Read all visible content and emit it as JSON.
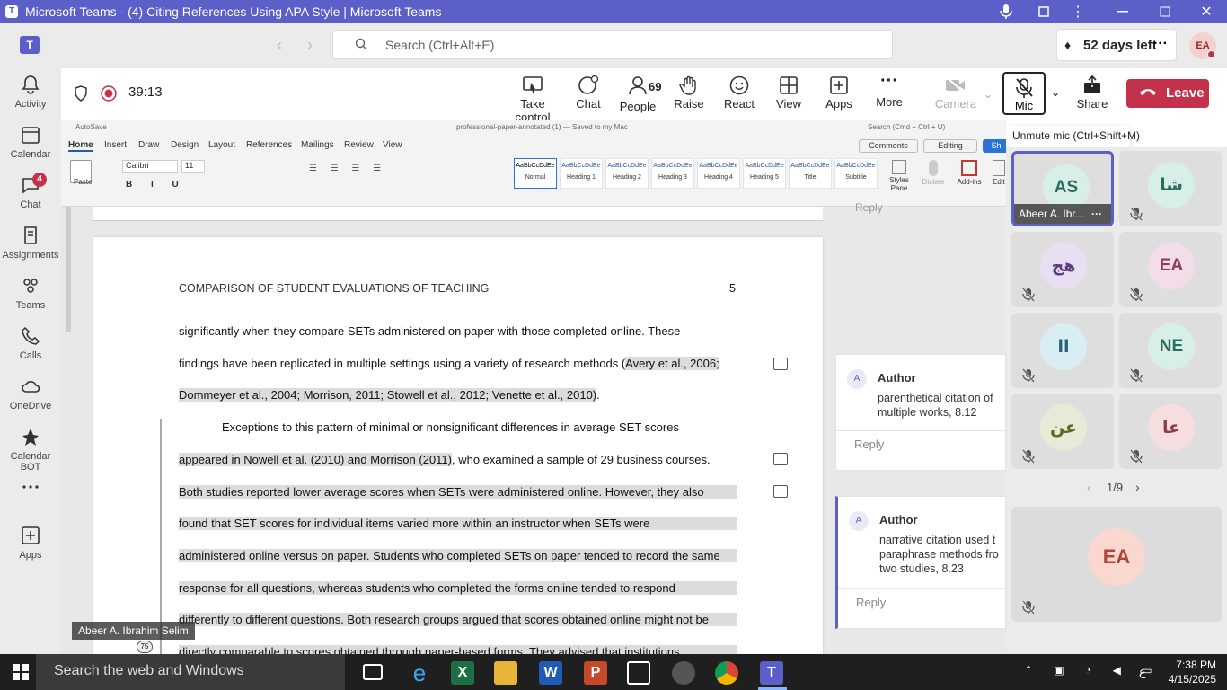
{
  "window": {
    "title": "Microsoft Teams - (4) Citing References Using APA Style | Microsoft Teams"
  },
  "topbar": {
    "search_placeholder": "Search (Ctrl+Alt+E)",
    "days_left": "52 days left",
    "avatar": "EA"
  },
  "rail": [
    {
      "label": "Activity",
      "icon": "bell-icon"
    },
    {
      "label": "Calendar",
      "icon": "calendar-icon"
    },
    {
      "label": "Chat",
      "icon": "chat-icon",
      "badge": "4"
    },
    {
      "label": "Assignments",
      "icon": "assignments-icon"
    },
    {
      "label": "Teams",
      "icon": "teams-icon"
    },
    {
      "label": "Calls",
      "icon": "phone-icon"
    },
    {
      "label": "OneDrive",
      "icon": "cloud-icon"
    },
    {
      "label": "Calendar BOT",
      "icon": "bot-icon"
    },
    {
      "label": "",
      "icon": "more-icon"
    },
    {
      "label": "Apps",
      "icon": "apps-icon"
    }
  ],
  "meeting": {
    "timer": "39:13",
    "take_control": "Take control",
    "chat": "Chat",
    "people_count": "69",
    "people": "People",
    "raise": "Raise",
    "react": "React",
    "view": "View",
    "apps": "Apps",
    "more": "More",
    "camera": "Camera",
    "mic": "Mic",
    "share": "Share",
    "leave": "Leave",
    "tooltip": "Unmute mic (Ctrl+Shift+M)"
  },
  "word": {
    "autosave": "AutoSave",
    "filename": "professional-paper-annotated (1) — Saved to my Mac",
    "search": "Search (Cmd + Ctrl + U)",
    "tabs": [
      "Home",
      "Insert",
      "Draw",
      "Design",
      "Layout",
      "References",
      "Mailings",
      "Review",
      "View"
    ],
    "comments_btn": "Comments",
    "editing_btn": "Editing",
    "font": "Calibri",
    "size": "11",
    "paste": "Paste",
    "styles": [
      "Normal",
      "Heading 1",
      "Heading 2",
      "Heading 3",
      "Heading 4",
      "Heading 5",
      "Title",
      "Subtitle"
    ],
    "style_sample": "AaBbCcDdEe",
    "styles_pane": "Styles Pane",
    "dictate": "Dictate",
    "addins": "Add-ins",
    "edit": "Edit",
    "share_short": "Sh",
    "reply_top": "Reply"
  },
  "document": {
    "header": "COMPARISON OF STUDENT EVALUATIONS OF TEACHING",
    "page_num": "5",
    "l1": "significantly when they compare SETs administered on paper with those completed online. These",
    "l2a": "findings have been replicated in multiple settings using a variety of research methods (",
    "l2b": "Avery et al., 2006;",
    "l3a": "Dommeyer et al., 2004; Morrison, 2011; Stowell et al., 2012; Venette et al., 2010)",
    "l3b": ".",
    "l4": "Exceptions to this pattern of minimal or nonsignificant differences in average SET scores",
    "l5a": "appeared in Nowell et al. (2010) and Morrison (2011)",
    "l5b": ", who examined a sample of 29 business courses.",
    "l6": "Both studies reported lower average scores when SETs were administered online. However, they also",
    "l7": "found that SET scores for individual items varied more within an instructor when SETs were",
    "l8": "administered online versus on paper. Students who completed SETs on paper tended to record the same",
    "l9": "response for all questions, whereas students who completed the forms online tended to respond",
    "l10": "differently to different questions. Both research groups argued that scores obtained online might not be",
    "l11": "directly comparable to scores obtained through paper-based forms. They advised that institutions"
  },
  "comments": [
    {
      "avatar": "A",
      "author": "Author",
      "text1": "parenthetical citation of",
      "text2": "multiple works, 8.12",
      "reply": "Reply"
    },
    {
      "avatar": "A",
      "author": "Author",
      "text1": "narrative citation used t",
      "text2": "paraphrase methods fro",
      "text3": "two studies, 8.23",
      "reply": "Reply"
    }
  ],
  "gallery": {
    "tiles": [
      {
        "initials": "AS",
        "name": "Abeer A. Ibr...",
        "active": true
      },
      {
        "initials": "شا"
      },
      {
        "initials": "هج"
      },
      {
        "initials": "EA"
      },
      {
        "initials": "اا"
      },
      {
        "initials": "NE"
      },
      {
        "initials": "عن"
      },
      {
        "initials": "عا"
      }
    ],
    "pager": "1/9",
    "self": "EA"
  },
  "presenter": "Abeer A. Ibrahim Selim",
  "zoom": "75",
  "taskbar": {
    "search": "Search the web and Windows",
    "time": "7:38 PM",
    "date": "4/15/2025",
    "lang": "ع"
  }
}
